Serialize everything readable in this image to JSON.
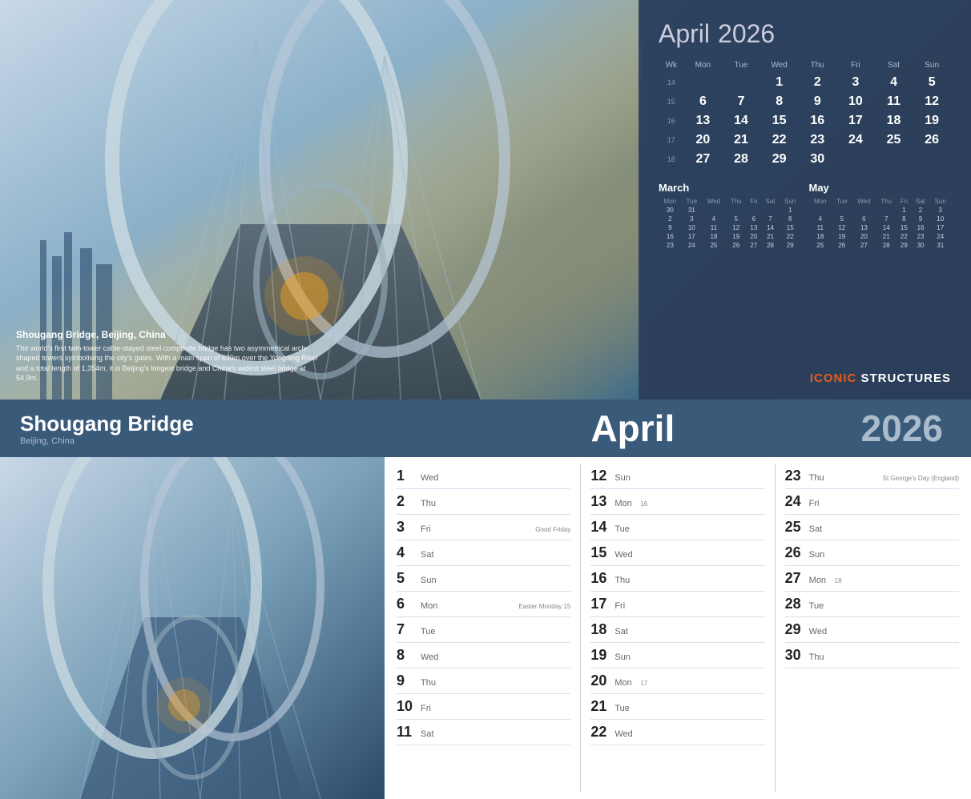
{
  "top": {
    "caption_title": "Shougang Bridge, Beijing, China",
    "caption_text": "The world's first twin-tower cable-stayed steel composite bridge has two asymmetrical arch-shaped towers symbolising the city's gates. With a main span of 639m over the Yongding River and a total length of 1,354m, it is Beijing's longest bridge and China's widest steel bridge at 54.9m.",
    "month_title": "April",
    "year": "2026",
    "brand_iconic": "ICONIC",
    "brand_structures": " STRUCTURES"
  },
  "main_calendar": {
    "headers": [
      "Wk",
      "Mon",
      "Tue",
      "Wed",
      "Thu",
      "Fri",
      "Sat",
      "Sun"
    ],
    "rows": [
      {
        "wk": "14",
        "days": [
          "",
          "",
          "1",
          "2",
          "3",
          "4",
          "5"
        ]
      },
      {
        "wk": "15",
        "days": [
          "6",
          "7",
          "8",
          "9",
          "10",
          "11",
          "12"
        ]
      },
      {
        "wk": "16",
        "days": [
          "13",
          "14",
          "15",
          "16",
          "17",
          "18",
          "19"
        ]
      },
      {
        "wk": "17",
        "days": [
          "20",
          "21",
          "22",
          "23",
          "24",
          "25",
          "26"
        ]
      },
      {
        "wk": "18",
        "days": [
          "27",
          "28",
          "29",
          "30",
          "",
          "",
          ""
        ]
      }
    ]
  },
  "mini_march": {
    "title": "March",
    "headers": [
      "Mon",
      "Tue",
      "Wed",
      "Thu",
      "Fri",
      "Sat",
      "Sun"
    ],
    "rows": [
      [
        "30",
        "31",
        "",
        "",
        "",
        "",
        "1"
      ],
      [
        "2",
        "3",
        "4",
        "5",
        "6",
        "7",
        "8"
      ],
      [
        "9",
        "10",
        "11",
        "12",
        "13",
        "14",
        "15"
      ],
      [
        "16",
        "17",
        "18",
        "19",
        "20",
        "21",
        "22"
      ],
      [
        "23",
        "24",
        "25",
        "26",
        "27",
        "28",
        "29"
      ]
    ]
  },
  "mini_may": {
    "title": "May",
    "headers": [
      "Mon",
      "Tue",
      "Wed",
      "Thu",
      "Fri",
      "Sat",
      "Sun"
    ],
    "rows": [
      [
        "",
        "",
        "",
        "",
        "1",
        "2",
        "3"
      ],
      [
        "4",
        "5",
        "6",
        "7",
        "8",
        "9",
        "10"
      ],
      [
        "11",
        "12",
        "13",
        "14",
        "15",
        "16",
        "17"
      ],
      [
        "18",
        "19",
        "20",
        "21",
        "22",
        "23",
        "24"
      ],
      [
        "25",
        "26",
        "27",
        "28",
        "29",
        "30",
        "31"
      ]
    ]
  },
  "bottom": {
    "location_title": "Shougang Bridge",
    "location_sub": "Beijing, China",
    "month": "April",
    "year": "2026"
  },
  "dates_col1": [
    {
      "num": "1",
      "day": "Wed",
      "note": ""
    },
    {
      "num": "2",
      "day": "Thu",
      "note": ""
    },
    {
      "num": "3",
      "day": "Fri",
      "note": "Good Friday"
    },
    {
      "num": "4",
      "day": "Sat",
      "note": ""
    },
    {
      "num": "5",
      "day": "Sun",
      "note": ""
    },
    {
      "num": "6",
      "day": "Mon",
      "note": "Easter Monday 15"
    },
    {
      "num": "7",
      "day": "Tue",
      "note": ""
    },
    {
      "num": "8",
      "day": "Wed",
      "note": ""
    },
    {
      "num": "9",
      "day": "Thu",
      "note": ""
    },
    {
      "num": "10",
      "day": "Fri",
      "note": ""
    },
    {
      "num": "11",
      "day": "Sat",
      "note": ""
    }
  ],
  "dates_col2": [
    {
      "num": "12",
      "day": "Sun",
      "note": "",
      "wk": ""
    },
    {
      "num": "13",
      "day": "Mon",
      "note": "",
      "wk": "16"
    },
    {
      "num": "14",
      "day": "Tue",
      "note": ""
    },
    {
      "num": "15",
      "day": "Wed",
      "note": ""
    },
    {
      "num": "16",
      "day": "Thu",
      "note": ""
    },
    {
      "num": "17",
      "day": "Fri",
      "note": ""
    },
    {
      "num": "18",
      "day": "Sat",
      "note": ""
    },
    {
      "num": "19",
      "day": "Sun",
      "note": ""
    },
    {
      "num": "20",
      "day": "Mon",
      "note": "",
      "wk": "17"
    },
    {
      "num": "21",
      "day": "Tue",
      "note": ""
    },
    {
      "num": "22",
      "day": "Wed",
      "note": ""
    }
  ],
  "dates_col3": [
    {
      "num": "23",
      "day": "Thu",
      "note": "St George's Day (England)"
    },
    {
      "num": "24",
      "day": "Fri",
      "note": ""
    },
    {
      "num": "25",
      "day": "Sat",
      "note": ""
    },
    {
      "num": "26",
      "day": "Sun",
      "note": ""
    },
    {
      "num": "27",
      "day": "Mon",
      "note": "",
      "wk": "18"
    },
    {
      "num": "28",
      "day": "Tue",
      "note": ""
    },
    {
      "num": "29",
      "day": "Wed",
      "note": ""
    },
    {
      "num": "30",
      "day": "Thu",
      "note": ""
    }
  ]
}
